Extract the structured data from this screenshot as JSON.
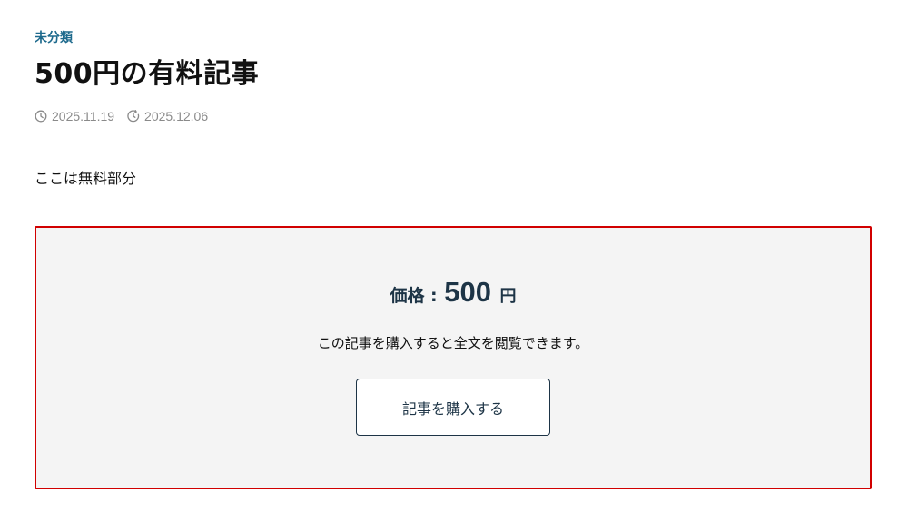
{
  "post": {
    "category": "未分類",
    "title": "500円の有料記事",
    "published_date": "2025.11.19",
    "updated_date": "2025.12.06",
    "free_text": "ここは無料部分"
  },
  "paywall": {
    "price_label": "価格 :",
    "price_value": "500",
    "price_unit": "円",
    "description": "この記事を購入すると全文を閲覧できます。",
    "buy_button_label": "記事を購入する",
    "border_color": "#d10000"
  },
  "icons": {
    "published": "clock-icon",
    "updated": "refresh-clock-icon"
  },
  "colors": {
    "category": "#1e6a8d",
    "accent_dark": "#1d3446",
    "meta_gray": "#8a8a8a",
    "panel_bg": "#f4f4f4"
  }
}
